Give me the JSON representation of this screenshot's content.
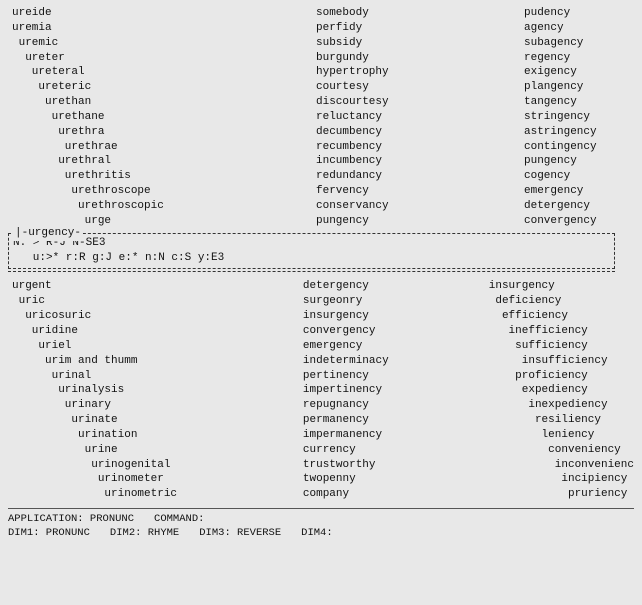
{
  "col_left_top": [
    "ureide",
    "uremia",
    "uremic",
    "ureter",
    "ureteral",
    "ureteric",
    "urethan",
    "urethane",
    "urethra",
    "urethrae",
    "urethral",
    "urethritis",
    "urethroscope",
    "urethroscopic",
    "urge"
  ],
  "col_center_top": [
    "somebody",
    "perfidy",
    "subsidy",
    "burgundy",
    "hypertrophy",
    "courtesy",
    "discourtesy",
    "reluctancy",
    "decumbency",
    "recumbency",
    "incumbency",
    "redundancy",
    "fervency",
    "conservancy",
    "pungency"
  ],
  "col_right_top": [
    "pudency",
    "agency",
    "subagency",
    "regency",
    "exigency",
    "plangency",
    "tangency",
    "stringency",
    "astringency",
    "contingency",
    "pungency",
    "cogency",
    "emergency",
    "detergency",
    "convergency"
  ],
  "urgency_box": {
    "label": "-urgency-",
    "lines": [
      "N: >*R-J*N-SE3",
      "   u:>* r:R g:J e:* n:N c:S y:E3"
    ]
  },
  "col_left_bottom": [
    "urgent",
    "uric",
    "uricosuric",
    "uridine",
    "uriel",
    "urim and thumm",
    "urinal",
    "urinalysis",
    "urinary",
    "urinate",
    "urination",
    "urine",
    "urinogenital",
    "urinometer",
    "urinometric"
  ],
  "col_center_bottom": [
    "detergency",
    "surgeonry",
    "insurgency",
    "convergency",
    "emergency",
    "indeterminacy",
    "pertinency",
    "impertinency",
    "repugnancy",
    "permanency",
    "impermanency",
    "currency",
    "trustworthy",
    "twopenny",
    "company"
  ],
  "col_right_bottom": [
    "insurgency",
    "deficiency",
    "efficiency",
    "inefficiency",
    "sufficiency",
    "insufficiency",
    "proficiency",
    "expediency",
    "inexpediency",
    "resiliency",
    "leniency",
    "conveniency",
    "inconvenienc",
    "incipiency",
    "pruriency"
  ],
  "status": {
    "application_label": "APPLICATION: PRONUNC",
    "command_label": "COMMAND:",
    "dim1_label": "DIM1: PRONUNC",
    "dim2_label": "DIM2: RHYME",
    "dim3_label": "DIM3: REVERSE",
    "dim4_label": "DIM4:"
  }
}
